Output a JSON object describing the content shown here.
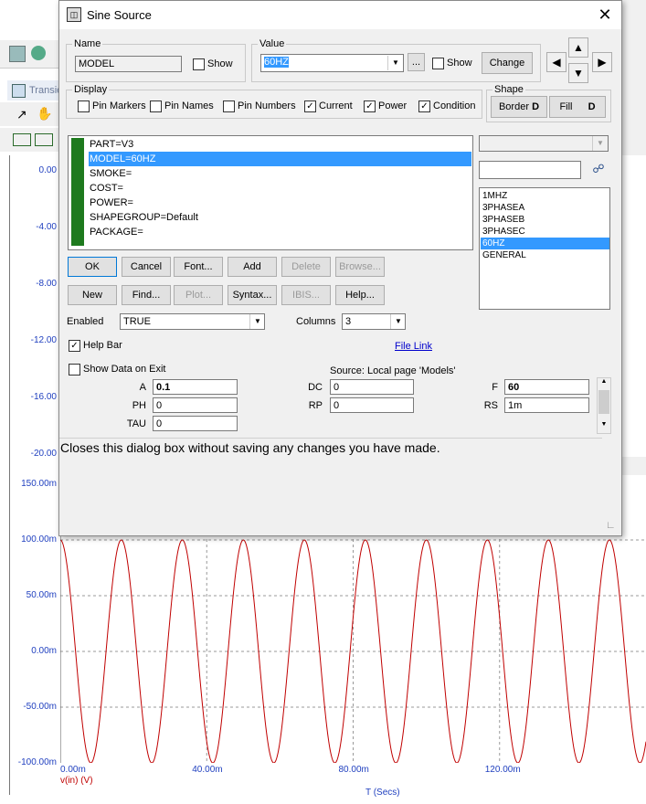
{
  "background": {
    "tab_label": "Transie",
    "plot_top": {
      "y_ticks": [
        "0.00",
        "-4.00",
        "-8.00",
        "-12.00",
        "-16.00",
        "-20.00"
      ]
    },
    "plot_bottom": {
      "y_ticks": [
        "150.00m",
        "100.00m",
        "50.00m",
        "0.00m",
        "-50.00m",
        "-100.00m"
      ],
      "x_ticks": [
        "0.00m",
        "40.00m",
        "80.00m",
        "120.00m"
      ],
      "x_title": "T (Secs)",
      "trace_label": "v(in) (V)",
      "trace_color": "#c00000"
    }
  },
  "chart_data": {
    "type": "line",
    "series": [
      {
        "name": "v(in) (V)",
        "amplitude": 0.1,
        "frequency_hz": 60
      }
    ],
    "xlabel": "T (Secs)",
    "ylabel": "",
    "xlim": [
      0,
      0.16
    ],
    "ylim": [
      -0.1,
      0.15
    ],
    "grid": true
  },
  "dialog": {
    "title": "Sine Source",
    "name_group": {
      "label": "Name",
      "value": "MODEL",
      "show_label": "Show",
      "show_checked": false
    },
    "value_group": {
      "label": "Value",
      "value": "60HZ",
      "ellipsis": "...",
      "show_label": "Show",
      "show_checked": false,
      "change_label": "Change"
    },
    "display_group": {
      "label": "Display",
      "items": [
        {
          "label": "Pin Markers",
          "checked": false
        },
        {
          "label": "Pin Names",
          "checked": false
        },
        {
          "label": "Pin Numbers",
          "checked": false
        },
        {
          "label": "Current",
          "checked": true
        },
        {
          "label": "Power",
          "checked": true
        },
        {
          "label": "Condition",
          "checked": true
        }
      ]
    },
    "shape_group": {
      "label": "Shape",
      "border_label": "Border",
      "fill_label": "Fill"
    },
    "attributes": [
      {
        "text": "PART=V3",
        "selected": false
      },
      {
        "text": "MODEL=60HZ",
        "selected": true
      },
      {
        "text": "SMOKE=",
        "selected": false
      },
      {
        "text": "COST=",
        "selected": false
      },
      {
        "text": "POWER=",
        "selected": false
      },
      {
        "text": "SHAPEGROUP=Default",
        "selected": false
      },
      {
        "text": "PACKAGE=",
        "selected": false
      }
    ],
    "models": [
      {
        "text": "1MHZ",
        "selected": false
      },
      {
        "text": "3PHASEA",
        "selected": false
      },
      {
        "text": "3PHASEB",
        "selected": false
      },
      {
        "text": "3PHASEC",
        "selected": false
      },
      {
        "text": "60HZ",
        "selected": true
      },
      {
        "text": "GENERAL",
        "selected": false
      }
    ],
    "buttons_row1": [
      "OK",
      "Cancel",
      "Font...",
      "Add",
      "Delete",
      "Browse..."
    ],
    "buttons_row2": [
      "New",
      "Find...",
      "Plot...",
      "Syntax...",
      "IBIS...",
      "Help..."
    ],
    "enabled_label": "Enabled",
    "enabled_value": "TRUE",
    "columns_label": "Columns",
    "columns_value": "3",
    "help_bar_label": "Help Bar",
    "help_bar_checked": true,
    "file_link": "File Link",
    "show_data_label": "Show Data on Exit",
    "show_data_checked": false,
    "source_text": "Source: Local page 'Models'",
    "params": {
      "A": {
        "label": "A",
        "value": "0.1"
      },
      "PH": {
        "label": "PH",
        "value": "0"
      },
      "TAU": {
        "label": "TAU",
        "value": "0"
      },
      "DC": {
        "label": "DC",
        "value": "0"
      },
      "RP": {
        "label": "RP",
        "value": "0"
      },
      "F": {
        "label": "F",
        "value": "60"
      },
      "RS": {
        "label": "RS",
        "value": "1m"
      }
    },
    "help_text": "Closes this dialog box without saving any changes you have made."
  }
}
